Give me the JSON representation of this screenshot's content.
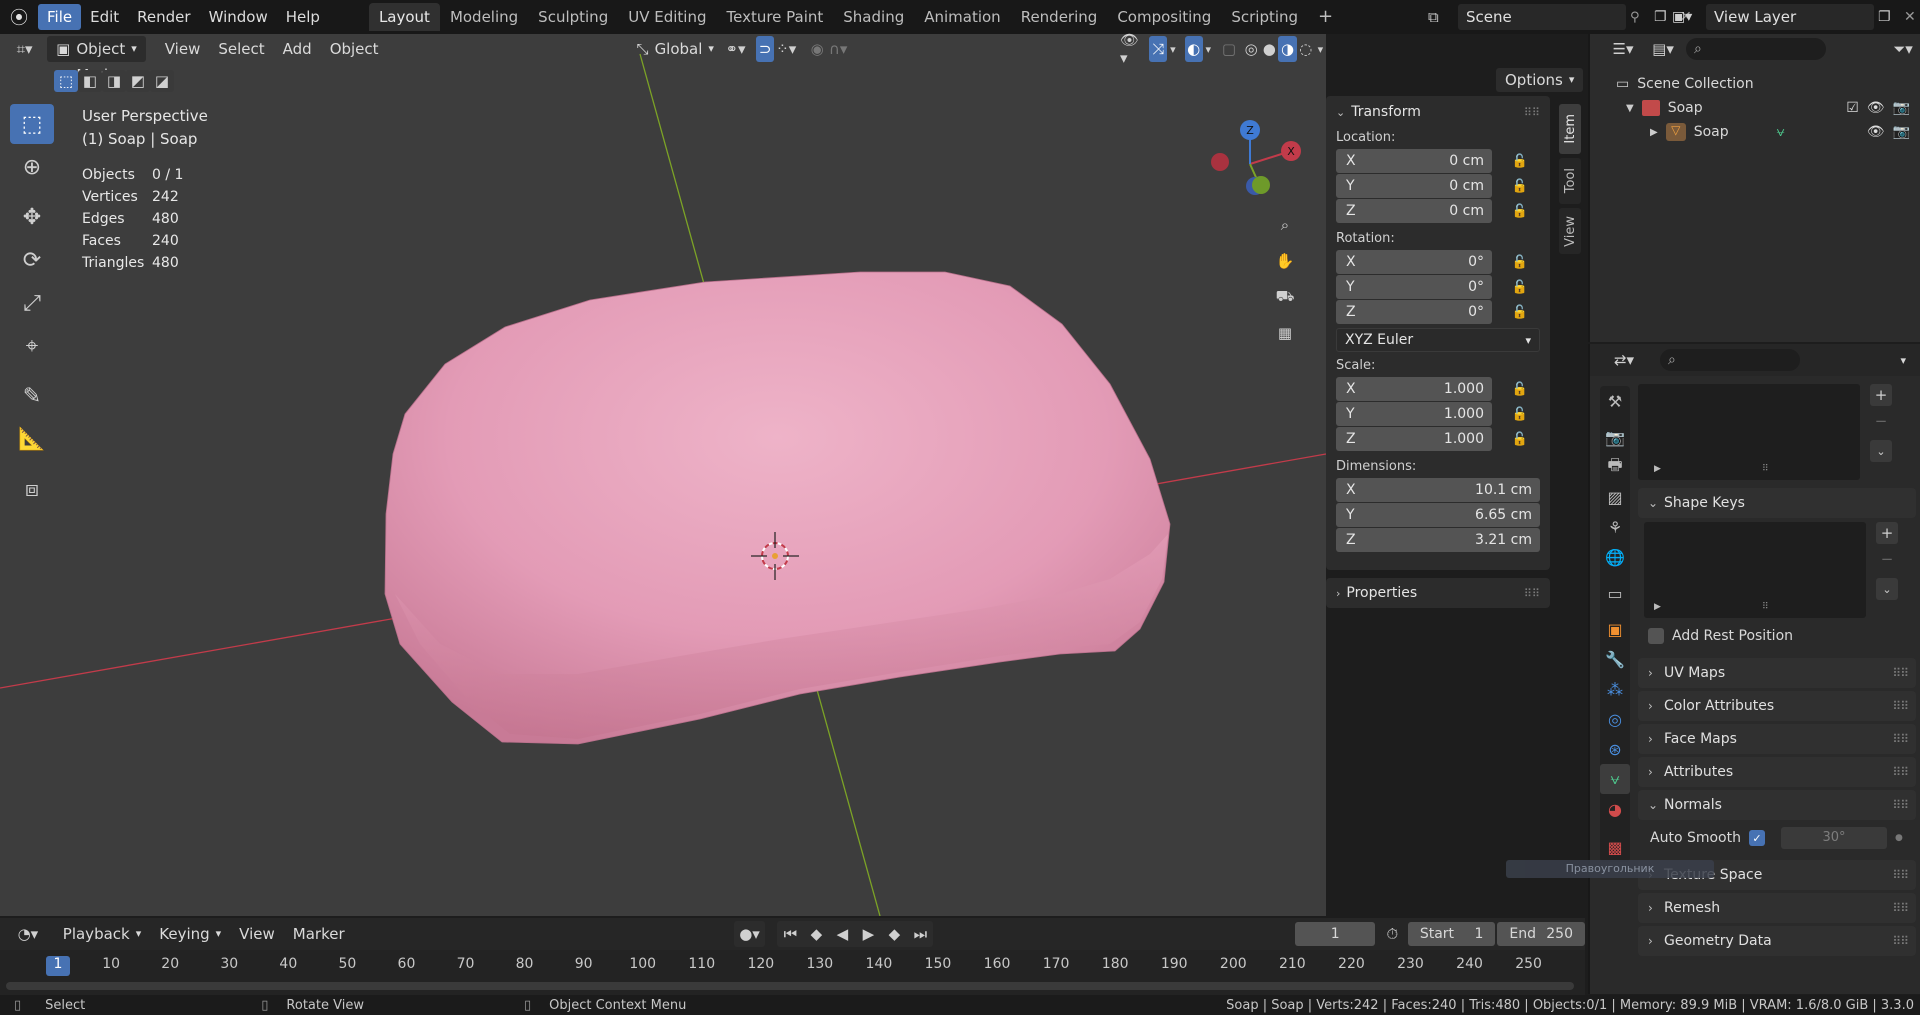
{
  "topbar": {
    "menus": [
      "File",
      "Edit",
      "Render",
      "Window",
      "Help"
    ],
    "workspaces": [
      "Layout",
      "Modeling",
      "Sculpting",
      "UV Editing",
      "Texture Paint",
      "Shading",
      "Animation",
      "Rendering",
      "Compositing",
      "Scripting"
    ],
    "add_workspace": "+",
    "scene": "Scene",
    "view_layer": "View Layer"
  },
  "viewport_header": {
    "mode": "Object Mode",
    "menus": [
      "View",
      "Select",
      "Add",
      "Object"
    ],
    "orientation": "Global",
    "options": "Options"
  },
  "viewport_info": {
    "perspective": "User Perspective",
    "object": "(1) Soap | Soap",
    "stats": [
      {
        "label": "Objects",
        "value": "0 / 1"
      },
      {
        "label": "Vertices",
        "value": "242"
      },
      {
        "label": "Edges",
        "value": "480"
      },
      {
        "label": "Faces",
        "value": "240"
      },
      {
        "label": "Triangles",
        "value": "480"
      }
    ]
  },
  "gizmo": {
    "x": "X",
    "y": "Y",
    "z": "Z"
  },
  "npanel": {
    "transform_title": "Transform",
    "location_label": "Location:",
    "location": [
      {
        "axis": "X",
        "value": "0 cm"
      },
      {
        "axis": "Y",
        "value": "0 cm"
      },
      {
        "axis": "Z",
        "value": "0 cm"
      }
    ],
    "rotation_label": "Rotation:",
    "rotation": [
      {
        "axis": "X",
        "value": "0°"
      },
      {
        "axis": "Y",
        "value": "0°"
      },
      {
        "axis": "Z",
        "value": "0°"
      }
    ],
    "rotation_mode": "XYZ Euler",
    "scale_label": "Scale:",
    "scale": [
      {
        "axis": "X",
        "value": "1.000"
      },
      {
        "axis": "Y",
        "value": "1.000"
      },
      {
        "axis": "Z",
        "value": "1.000"
      }
    ],
    "dimensions_label": "Dimensions:",
    "dimensions": [
      {
        "axis": "X",
        "value": "10.1 cm"
      },
      {
        "axis": "Y",
        "value": "6.65 cm"
      },
      {
        "axis": "Z",
        "value": "3.21 cm"
      }
    ],
    "properties_title": "Properties",
    "tabs": [
      "Item",
      "Tool",
      "View"
    ]
  },
  "outliner": {
    "collection": "Scene Collection",
    "items": [
      {
        "label": "Soap",
        "level": 1
      },
      {
        "label": "Soap",
        "level": 2
      }
    ]
  },
  "properties": {
    "shape_keys": "Shape Keys",
    "add_rest_position": "Add Rest Position",
    "panels": [
      "UV Maps",
      "Color Attributes",
      "Face Maps",
      "Attributes"
    ],
    "normals": "Normals",
    "auto_smooth_label": "Auto Smooth",
    "auto_smooth_angle": "30°",
    "tooltip": "Правоугольник",
    "panels_after": [
      "Texture Space",
      "Remesh",
      "Geometry Data"
    ]
  },
  "timeline": {
    "menus": [
      "Playback",
      "Keying",
      "View",
      "Marker"
    ],
    "current_frame": "1",
    "start_label": "Start",
    "start": "1",
    "end_label": "End",
    "end": "250",
    "ticks": [
      "1",
      "10",
      "20",
      "30",
      "40",
      "50",
      "60",
      "70",
      "80",
      "90",
      "100",
      "110",
      "120",
      "130",
      "140",
      "150",
      "160",
      "170",
      "180",
      "190",
      "200",
      "210",
      "220",
      "230",
      "240",
      "250"
    ]
  },
  "statusbar": {
    "left": [
      {
        "label": "Select"
      },
      {
        "label": "Rotate View"
      },
      {
        "label": "Object Context Menu"
      }
    ],
    "right": "Soap | Soap | Verts:242 | Faces:240 | Tris:480 | Objects:0/1 | Memory: 89.9 MiB | VRAM: 1.6/8.0 GiB | 3.3.0"
  },
  "colors": {
    "accent": "#4772b3",
    "soap": "#e8a3bd",
    "x_axis": "#c23b4a",
    "y_axis": "#7ca326"
  }
}
